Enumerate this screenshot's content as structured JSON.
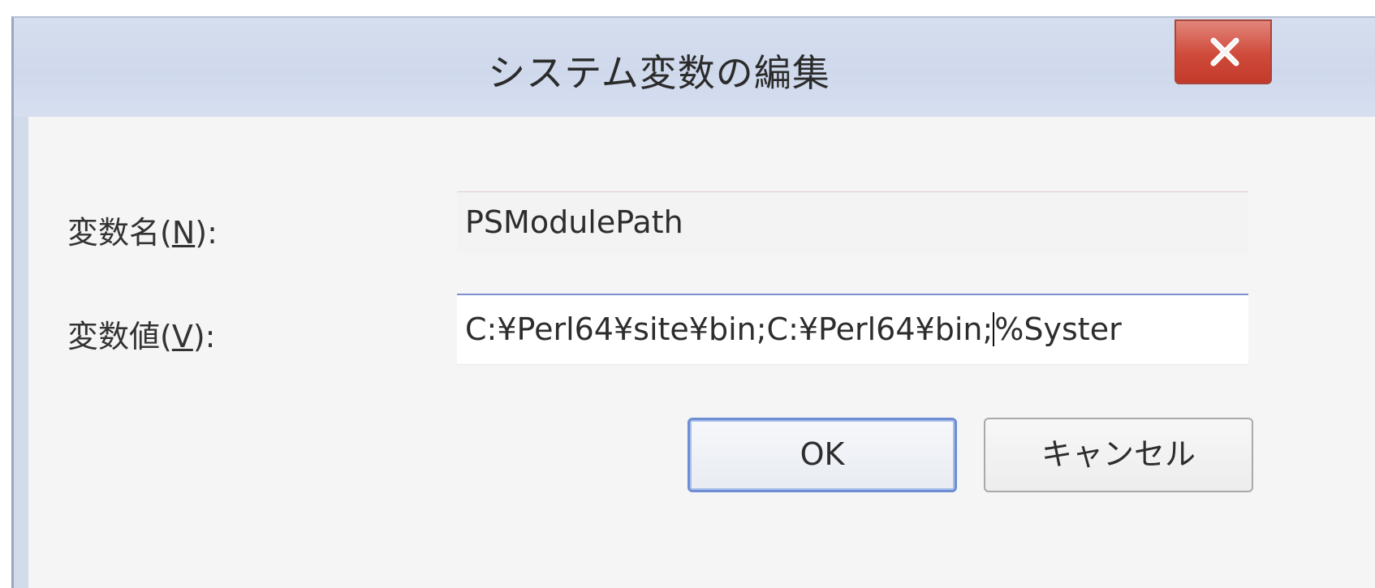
{
  "dialog": {
    "title": "システム変数の編集",
    "close_label": "X"
  },
  "fields": {
    "name": {
      "label_prefix": "変数名(",
      "label_accel": "N",
      "label_suffix": "):",
      "value": "PSModulePath"
    },
    "value": {
      "label_prefix": "変数値(",
      "label_accel": "V",
      "label_suffix": "):",
      "value_before_caret": "C:¥Perl64¥site¥bin;C:¥Perl64¥bin;",
      "value_after_caret": "%Syster"
    }
  },
  "buttons": {
    "ok_label": "OK",
    "cancel_label": "キャンセル"
  },
  "colors": {
    "titlebar": "#d5deee",
    "close_button": "#cf4a3a",
    "focus_border": "#6d8ed3"
  }
}
